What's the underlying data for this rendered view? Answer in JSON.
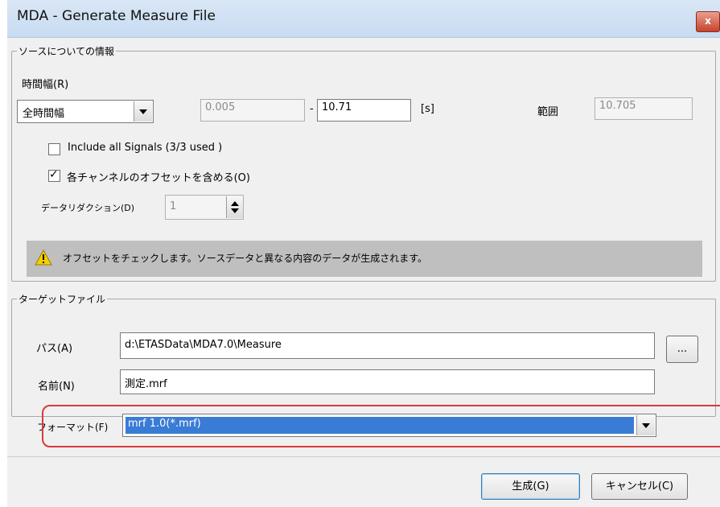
{
  "window": {
    "title": "MDA - Generate Measure File",
    "close_label": "x"
  },
  "source_group": {
    "legend": "ソースについての情報",
    "time_range_label": "時間幅(R)",
    "time_range_select": "全時間幅",
    "start_value": "0.005",
    "separator": "-",
    "end_value": "10.71",
    "unit": "[s]",
    "range_label": "範囲",
    "range_value": "10.705",
    "include_all_signals": {
      "label": "Include all Signals (3/3 used )",
      "checked": false
    },
    "include_offsets": {
      "label": "各チャンネルのオフセットを含める(O)",
      "checked": true
    },
    "data_reduction_label": "データリダクション(D)",
    "data_reduction_value": "1",
    "warning_text": "オフセットをチェックします。ソースデータと異なる内容のデータが生成されます。"
  },
  "target_group": {
    "legend": "ターゲットファイル",
    "path_label": "パス(A)",
    "path_value": "d:\\ETASData\\MDA7.0\\Measure",
    "browse_label": "...",
    "name_label": "名前(N)",
    "name_value": "測定.mrf",
    "format_label": "フォーマット(F)",
    "format_value": "mrf 1.0(*.mrf)"
  },
  "buttons": {
    "generate": "生成(G)",
    "cancel": "キャンセル(C)"
  },
  "colors": {
    "highlight": "#3a7bd5",
    "annotation_red": "#d93a3a",
    "warning_bar": "#bfbfbf"
  }
}
